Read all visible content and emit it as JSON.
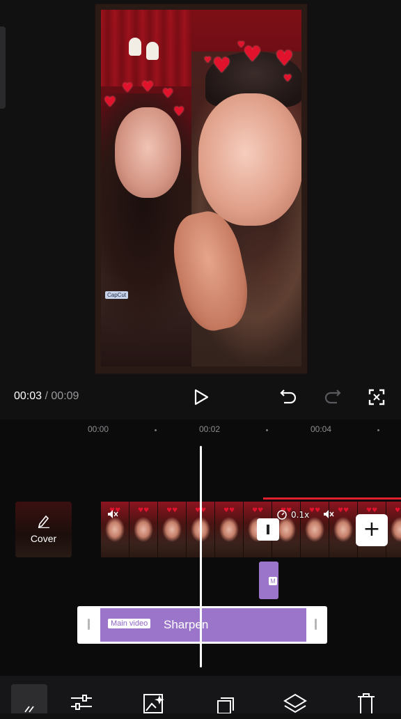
{
  "playback": {
    "current_time": "00:03",
    "separator": "/",
    "total_time": "00:09"
  },
  "ruler": {
    "labels": [
      "00:00",
      "00:02",
      "00:04"
    ]
  },
  "preview": {
    "watermark_text": "CapCut"
  },
  "cover": {
    "label": "Cover"
  },
  "strip": {
    "speed_label": "0.1x"
  },
  "small_clip": {
    "label": "M"
  },
  "effect": {
    "badge": "Main video",
    "name": "Sharpen",
    "color": "#9b75c9"
  },
  "icons": {
    "play": "play-icon",
    "undo": "undo-icon",
    "redo": "redo-icon",
    "fullscreen": "fullscreen-icon",
    "toolbar": [
      "back-icon",
      "adjust-icon",
      "image-effect-icon",
      "copy-icon",
      "layers-icon",
      "delete-icon"
    ]
  }
}
